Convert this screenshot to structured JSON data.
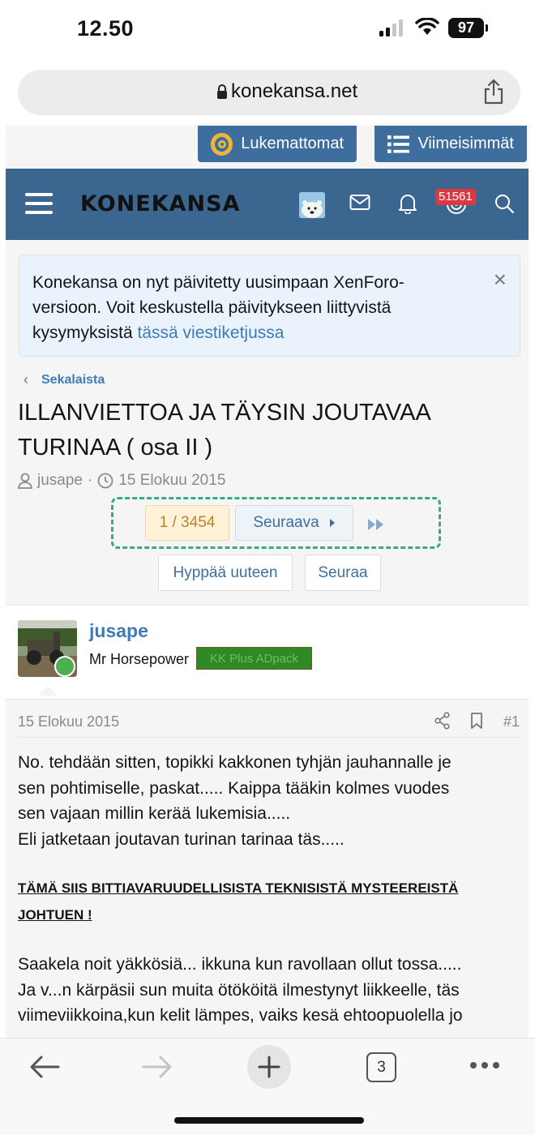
{
  "status_bar": {
    "time": "12.50",
    "battery": "97"
  },
  "browser": {
    "url": "konekansa.net",
    "tab_count": "3"
  },
  "top_buttons": {
    "unread": "Lukemattomat",
    "latest": "Viimeisimmät"
  },
  "header": {
    "logo": "KONEKANSA",
    "alerts_badge": "51561"
  },
  "notice": {
    "text": "Konekansa on nyt päivitetty uusimpaan XenForo-versioon. Voit keskustella päivitykseen liittyvistä kysymyksistä ",
    "link": "tässä viestiketjussa",
    "close": "×"
  },
  "breadcrumb": {
    "label": "Sekalaista"
  },
  "thread": {
    "title": "ILLANVIETTOA JA TÄYSIN JOUTAVAA TURINAA ( osa II )",
    "author": "jusape",
    "date": "15 Elokuu 2015"
  },
  "pagination": {
    "current": "1 / 3454",
    "next": "Seuraava"
  },
  "actions": {
    "jump": "Hyppää uuteen",
    "watch": "Seuraa"
  },
  "post": {
    "username": "jusape",
    "user_title": "Mr Horsepower",
    "banner": "KK Plus ADpack",
    "date": "15 Elokuu 2015",
    "number": "#1",
    "paragraph1_line1": "No. tehdään sitten, topikki kakkonen tyhjän jauhannalle je",
    "paragraph1_line2": "sen pohtimiselle, paskat..... Kaippa tääkin kolmes vuodes",
    "paragraph1_line3": "sen vajaan millin kerää lukemisia.....",
    "paragraph1_line4": "Eli jatketaan joutavan turinan tarinaa täs.....",
    "bold_line1": "TÄMÄ SIIS BITTIAVARUUDELLISISTA TEKNISISTÄ MYSTEEREISTÄ",
    "bold_line2": "JOHTUEN !",
    "paragraph2_line1": "Saakela noit yäkkösiä... ikkuna kun ravollaan ollut tossa.....",
    "paragraph2_line2": "Ja v...n kärpäsii sun muita ötököitä ilmestynyt liikkeelle, täs",
    "paragraph2_line3": "viimeviikkoina,kun kelit lämpes, vaiks kesä ehtoopuolella jo"
  },
  "colors": {
    "header": "#3a6690",
    "link": "#3f7ab6",
    "pager_current_bg": "#fff2d6",
    "highlight_outline": "#3aaa86"
  }
}
